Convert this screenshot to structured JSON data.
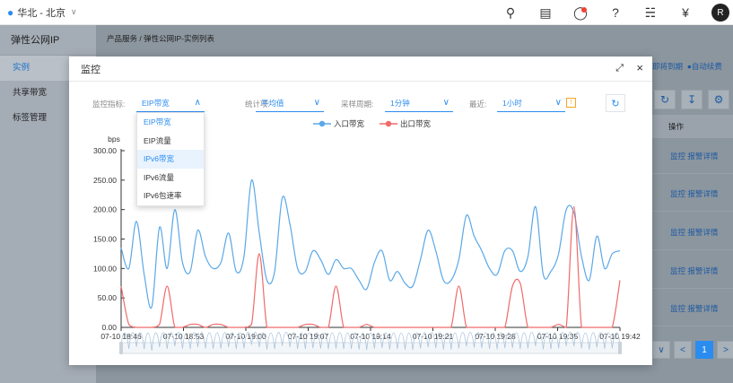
{
  "topbar": {
    "region": "华北 - 北京",
    "icons": [
      "search-icon",
      "document-icon",
      "message-icon",
      "help-icon",
      "network-icon",
      "currency-icon"
    ],
    "avatar": "R"
  },
  "sidebar": {
    "title": "弹性公网IP",
    "items": [
      {
        "label": "实例",
        "active": true
      },
      {
        "label": "共享带宽",
        "active": false
      },
      {
        "label": "标签管理",
        "active": false
      }
    ]
  },
  "main": {
    "breadcrumb": "产品服务 / 弹性公网IP-实例列表",
    "top_right": "即将到期",
    "auto_renew": "自动续费",
    "op_header": "操作",
    "row_actions": [
      "监控 报警详情",
      "监控 报警详情",
      "监控 报警详情",
      "监控 报警详情",
      "监控 报警详情"
    ],
    "pager_current": "1"
  },
  "modal": {
    "title": "监控",
    "filters": {
      "metric_label": "监控指标:",
      "metric_value": "EIP带宽",
      "stat_label": "统计项:",
      "stat_value": "平均值",
      "period_label": "采样周期:",
      "period_value": "1分钟",
      "recent_label": "最近:",
      "recent_value": "1小时"
    },
    "dropdown_options": [
      "EIP带宽",
      "EIP流量",
      "IPv6带宽",
      "IPv6流量",
      "IPv6包速率"
    ]
  },
  "chart_data": {
    "type": "line",
    "ylabel": "bps",
    "ylim": [
      0,
      300
    ],
    "yticks": [
      "0.00",
      "50.00",
      "100.00",
      "150.00",
      "200.00",
      "250.00",
      "300.00"
    ],
    "xticks": [
      "07-10 18:46",
      "07-10 18:53",
      "07-10 19:00",
      "07-10 19:07",
      "07-10 19:14",
      "07-10 19:21",
      "07-10 19:28",
      "07-10 19:35",
      "07-10 19:42"
    ],
    "legend": [
      "入口带宽",
      "出口带宽"
    ],
    "series": [
      {
        "name": "入口带宽",
        "color": "#5aa8e8",
        "values": [
          135,
          100,
          180,
          90,
          35,
          170,
          100,
          200,
          110,
          95,
          165,
          120,
          100,
          110,
          160,
          95,
          120,
          250,
          160,
          80,
          95,
          220,
          175,
          100,
          95,
          130,
          115,
          90,
          115,
          100,
          100,
          80,
          65,
          110,
          130,
          80,
          95,
          75,
          70,
          115,
          165,
          130,
          80,
          80,
          115,
          190,
          155,
          130,
          100,
          90,
          130,
          130,
          95,
          120,
          205,
          90,
          95,
          125,
          200,
          195,
          120,
          80,
          155,
          100,
          125,
          130
        ]
      },
      {
        "name": "出口带宽",
        "color": "#f06a6a",
        "values": [
          70,
          5,
          0,
          0,
          0,
          5,
          70,
          0,
          0,
          5,
          5,
          0,
          5,
          5,
          0,
          0,
          0,
          5,
          125,
          0,
          0,
          0,
          0,
          0,
          5,
          5,
          0,
          0,
          70,
          0,
          0,
          0,
          5,
          0,
          0,
          0,
          0,
          0,
          0,
          0,
          0,
          0,
          0,
          0,
          70,
          0,
          0,
          0,
          0,
          0,
          0,
          70,
          75,
          0,
          0,
          0,
          0,
          5,
          0,
          205,
          0,
          0,
          0,
          0,
          0,
          80
        ]
      }
    ]
  }
}
